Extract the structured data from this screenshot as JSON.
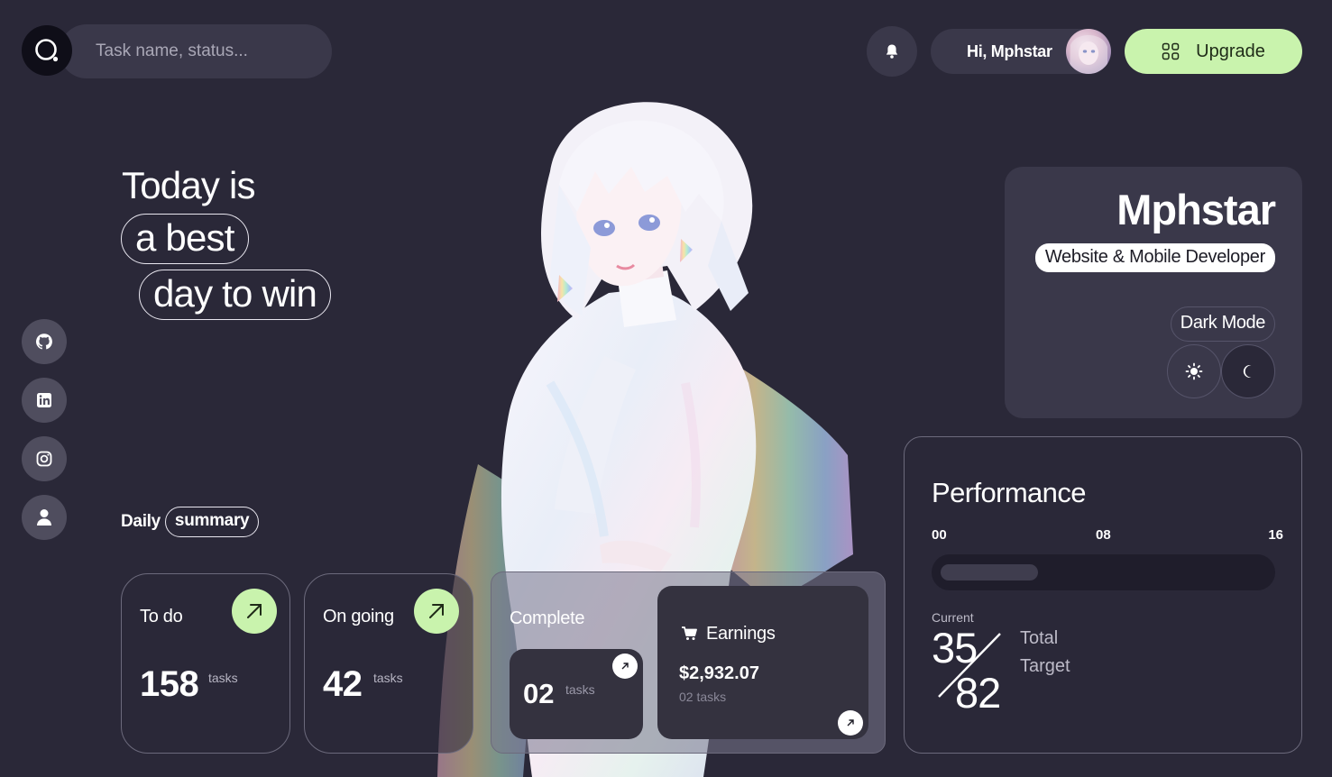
{
  "search": {
    "placeholder": "Task name, status..."
  },
  "header": {
    "greeting": "Hi, Mphstar",
    "upgrade_label": "Upgrade"
  },
  "headline": {
    "line1": "Today is",
    "line2": "a best",
    "line3": "day to win"
  },
  "socials": [
    {
      "icon": "github-icon"
    },
    {
      "icon": "linkedin-icon"
    },
    {
      "icon": "instagram-icon"
    },
    {
      "icon": "user-icon"
    }
  ],
  "summary": {
    "prefix": "Daily",
    "chip": "summary"
  },
  "cards": {
    "todo": {
      "title": "To do",
      "count": "158",
      "unit": "tasks"
    },
    "ongoing": {
      "title": "On going",
      "count": "42",
      "unit": "tasks"
    },
    "complete": {
      "title": "Complete",
      "count": "02",
      "unit": "tasks"
    },
    "earnings": {
      "title": "Earnings",
      "amount": "$2,932.07",
      "sub": "02 tasks"
    }
  },
  "profile": {
    "name": "Mphstar",
    "role": "Website & Mobile Developer",
    "mode_label": "Dark Mode"
  },
  "performance": {
    "title": "Performance",
    "ticks": [
      "00",
      "08",
      "16"
    ],
    "progress_fraction": 0.3,
    "current_label": "Current",
    "current": "35",
    "target": "82",
    "total_label": "Total",
    "target_label": "Target"
  },
  "colors": {
    "background": "#2a2838",
    "accent": "#c9f3ad",
    "panel": "#3a384a"
  }
}
